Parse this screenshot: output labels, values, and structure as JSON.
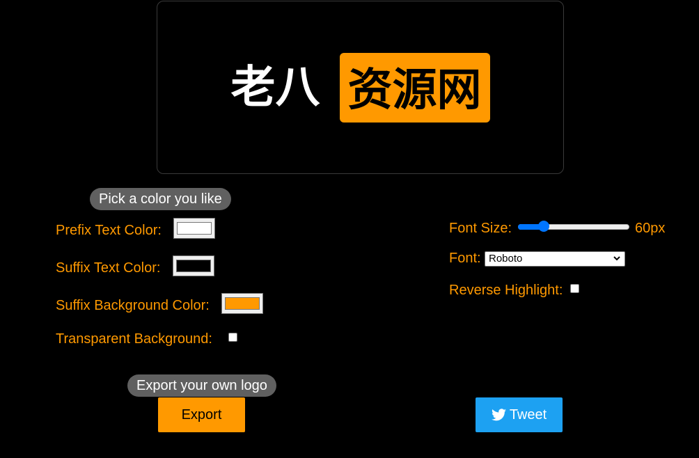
{
  "preview": {
    "prefix": "老八",
    "suffix": "资源网"
  },
  "colors": {
    "prefix_text": "#ffffff",
    "suffix_text": "#000000",
    "suffix_background": "#ff9900",
    "accent": "#ff9900",
    "tweet": "#1da1f2"
  },
  "color_section": {
    "pill": "Pick a color you like",
    "prefix_label": "Prefix Text Color:",
    "suffix_label": "Suffix Text Color:",
    "suffix_bg_label": "Suffix Background Color:",
    "transparent_label": "Transparent Background:",
    "transparent_checked": false
  },
  "font_section": {
    "size_label": "Font Size:",
    "size_value": "60px",
    "size_fraction": 0.2,
    "font_label": "Font:",
    "font_selected": "Roboto",
    "reverse_label": "Reverse Highlight:",
    "reverse_checked": false
  },
  "export_section": {
    "pill": "Export your own logo",
    "export_label": "Export",
    "tweet_label": "Tweet"
  },
  "icons": {
    "tweet": "twitter-bird-icon",
    "select_arrow": "chevron-down-icon"
  }
}
